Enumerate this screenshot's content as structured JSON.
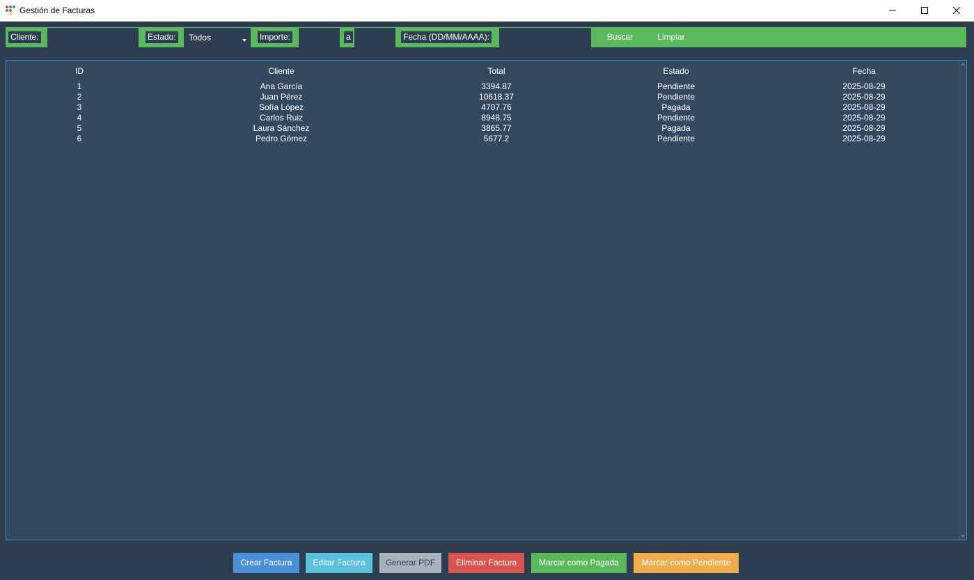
{
  "window": {
    "title": "Gestión de Facturas",
    "minimize_icon": "minimize-icon",
    "maximize_icon": "maximize-icon",
    "close_icon": "close-icon"
  },
  "filters": {
    "cliente_label": "Cliente:",
    "cliente_value": "",
    "estado_label": "Estado:",
    "estado_value": "Todos",
    "importe_label": "Importe:",
    "importe_min": "",
    "importe_sep": "a",
    "importe_max": "",
    "fecha_label": "Fecha (DD/MM/AAAA):",
    "fecha_value": "",
    "buscar_label": "Buscar",
    "limpiar_label": "Limpiar"
  },
  "table": {
    "columns": [
      "ID",
      "Cliente",
      "Total",
      "Estado",
      "Fecha"
    ],
    "rows": [
      [
        "1",
        "Ana García",
        "3394.87",
        "Pendiente",
        "2025-08-29"
      ],
      [
        "2",
        "Juan Pérez",
        "10618.37",
        "Pendiente",
        "2025-08-29"
      ],
      [
        "3",
        "Sofía López",
        "4707.76",
        "Pagada",
        "2025-08-29"
      ],
      [
        "4",
        "Carlos Ruiz",
        "8948.75",
        "Pendiente",
        "2025-08-29"
      ],
      [
        "5",
        "Laura Sánchez",
        "3865.77",
        "Pagada",
        "2025-08-29"
      ],
      [
        "6",
        "Pedro Gómez",
        "5677.2",
        "Pendiente",
        "2025-08-29"
      ]
    ]
  },
  "actions": {
    "crear": "Crear Factura",
    "editar": "Editar Factura",
    "pdf": "Generar PDF",
    "eliminar": "Eliminar Factura",
    "pagada": "Marcar como Pagada",
    "pendiente": "Marcar como Pendiente"
  },
  "colors": {
    "background": "#2c3e50",
    "table_bg": "#34495e",
    "filter_bar": "#5cb85c",
    "crear": "#4a90d9",
    "editar": "#5bc0de",
    "pdf": "#a8b2bd",
    "eliminar": "#d9534f",
    "pagada": "#5cb85c",
    "pendiente": "#f0ad4e"
  }
}
